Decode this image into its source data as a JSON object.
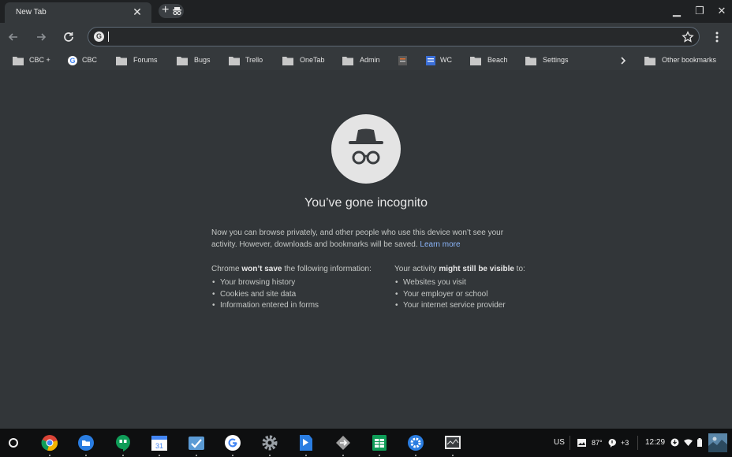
{
  "browser": {
    "tab_title": "New Tab",
    "tab_close": "✕",
    "new_tab": "+",
    "omnibox_value": "",
    "window_controls": [
      "▁",
      "❐",
      "✕"
    ]
  },
  "bookmarks": [
    {
      "label": "CBC +",
      "icon": "folder-icon"
    },
    {
      "label": "CBC",
      "icon": "google-icon"
    },
    {
      "label": "Forums",
      "icon": "folder-icon"
    },
    {
      "label": "Bugs",
      "icon": "folder-icon"
    },
    {
      "label": "Trello",
      "icon": "folder-icon"
    },
    {
      "label": "OneTab",
      "icon": "folder-icon"
    },
    {
      "label": "Admin",
      "icon": "folder-icon"
    },
    {
      "label": "",
      "icon": "site-icon"
    },
    {
      "label": "WC",
      "icon": "doc-icon"
    },
    {
      "label": "Beach",
      "icon": "folder-icon"
    },
    {
      "label": "Settings",
      "icon": "folder-icon"
    },
    {
      "label": "Other bookmarks",
      "icon": "folder-icon"
    }
  ],
  "incognito": {
    "heading": "You’ve gone incognito",
    "intro": "Now you can browse privately, and other people who use this device won’t see your activity. However, downloads and bookmarks will be saved.",
    "learn_more": "Learn more",
    "left_pre": "Chrome ",
    "left_bold": "won’t save",
    "left_post": " the following information:",
    "left_items": [
      "Your browsing history",
      "Cookies and site data",
      "Information entered in forms"
    ],
    "right_pre": "Your activity ",
    "right_bold": "might still be visible",
    "right_post": " to:",
    "right_items": [
      "Websites you visit",
      "Your employer or school",
      "Your internet service provider"
    ]
  },
  "shelf": {
    "apps": [
      "chrome-icon",
      "files-icon",
      "hangouts-icon",
      "calendar-icon",
      "tasks-icon",
      "google-icon",
      "settings-gear-icon",
      "play-books-icon",
      "deploy-icon",
      "sheets-icon",
      "chrome-settings-icon",
      "screen-icon"
    ],
    "calendar_day": "31",
    "tray": {
      "ime": "US",
      "temperature": "87°",
      "notifications": "+3",
      "clock": "12:29"
    }
  },
  "colors": {
    "tab_bg": "#35393c",
    "frame": "#1f2123",
    "content_bg": "#323639",
    "link": "#8ab4f8"
  }
}
